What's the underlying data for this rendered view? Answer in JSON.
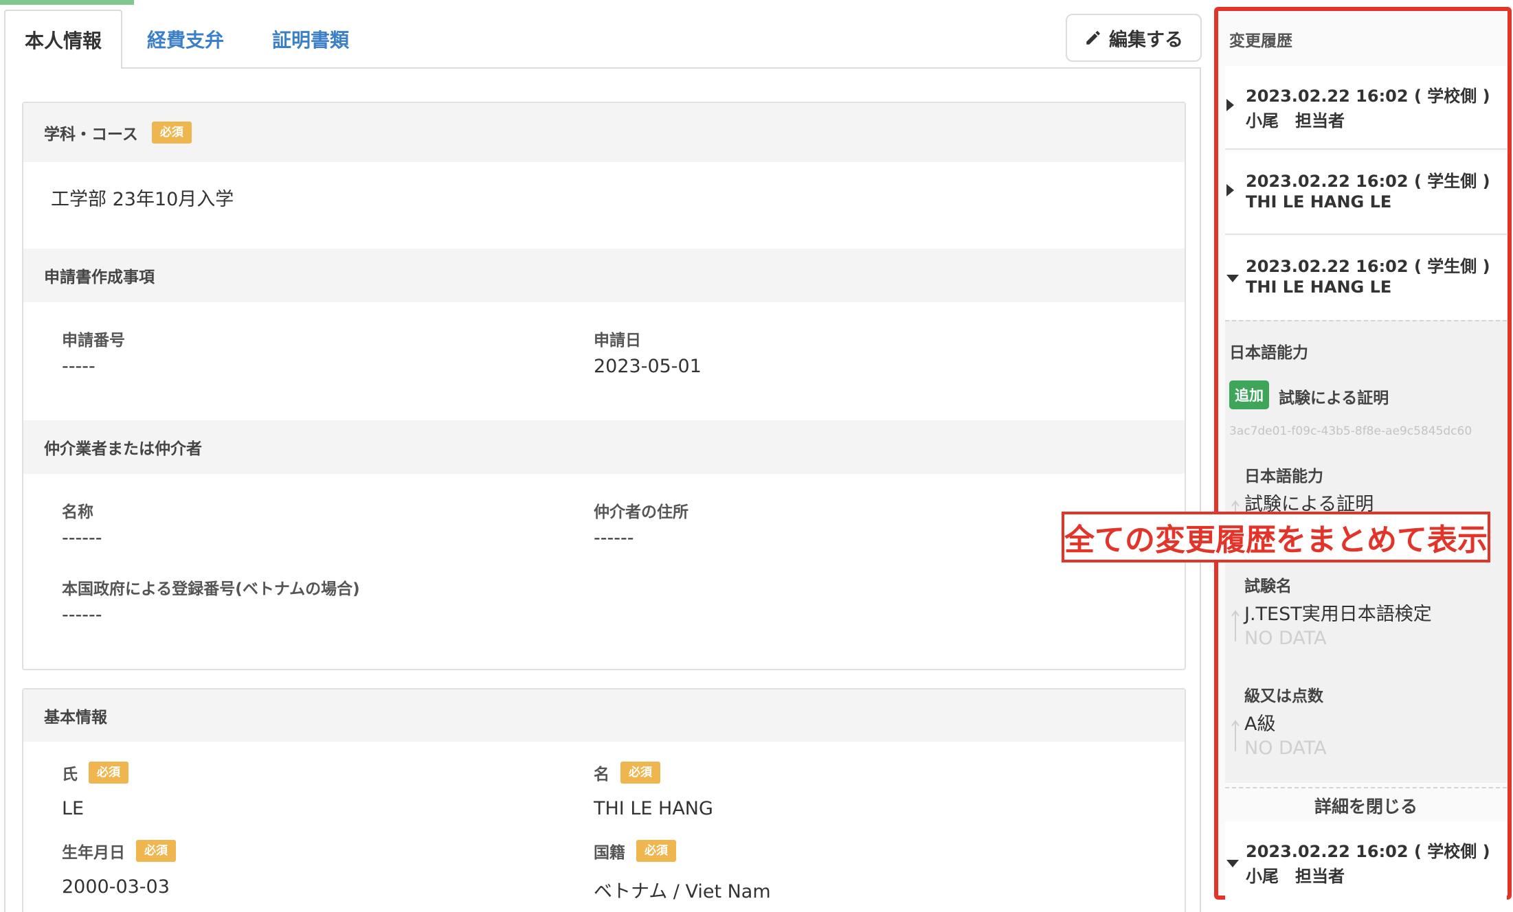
{
  "tabs": [
    {
      "label": "本人情報"
    },
    {
      "label": "経費支弁"
    },
    {
      "label": "証明書類"
    }
  ],
  "edit_button": {
    "label": "編集する"
  },
  "required_badge": "必須",
  "course_section": {
    "heading": "学科・コース",
    "value": "工学部 23年10月入学",
    "application": {
      "heading": "申請書作成事項",
      "fields": [
        {
          "label": "申請番号",
          "value": "-----"
        },
        {
          "label": "申請日",
          "value": "2023-05-01"
        }
      ]
    },
    "agent": {
      "heading": "仲介業者または仲介者",
      "fields": [
        {
          "label": "名称",
          "value": "------"
        },
        {
          "label": "仲介者の住所",
          "value": "------"
        },
        {
          "label": "本国政府による登録番号(ベトナムの場合)",
          "value": "------"
        }
      ]
    }
  },
  "basic_info": {
    "heading": "基本情報",
    "fields": [
      {
        "label": "氏",
        "value": "LE"
      },
      {
        "label": "名",
        "value": "THI LE HANG"
      },
      {
        "label": "生年月日",
        "value": "2000-03-03"
      },
      {
        "label": "国籍",
        "value": "ベトナム / Viet Nam"
      }
    ]
  },
  "history": {
    "title": "変更履歴",
    "entries": [
      {
        "datetime": "2023.02.22 16:02",
        "side": "( 学校側 )",
        "user": "小尾　担当者"
      },
      {
        "datetime": "2023.02.22 16:02",
        "side": "( 学生側 )",
        "user": "THI LE HANG LE"
      },
      {
        "datetime": "2023.02.22 16:02",
        "side": "( 学生側 )",
        "user": "THI LE HANG LE"
      },
      {
        "datetime": "2023.02.22 16:02",
        "side": "( 学校側 )",
        "user": "小尾　担当者"
      }
    ],
    "detail": {
      "category": "日本語能力",
      "action_badge": "追加",
      "record_type": "試験による証明",
      "record_id": "3ac7de01-f09c-43b5-8f8e-ae9c5845dc60",
      "changes": [
        {
          "label": "日本語能力",
          "new_value": "試験による証明",
          "old_value": ""
        },
        {
          "label": "試験名",
          "new_value": "J.TEST実用日本語検定",
          "old_value": "NO DATA"
        },
        {
          "label": "級又は点数",
          "new_value": "A級",
          "old_value": "NO DATA"
        }
      ],
      "close_label": "詳細を閉じる"
    }
  },
  "annotation": "全ての変更履歴をまとめて表示",
  "colors": {
    "accent_red": "#e3342a",
    "required_badge": "#efb54e",
    "add_badge": "#3fa55b",
    "tab_link": "#3a7fc7"
  }
}
